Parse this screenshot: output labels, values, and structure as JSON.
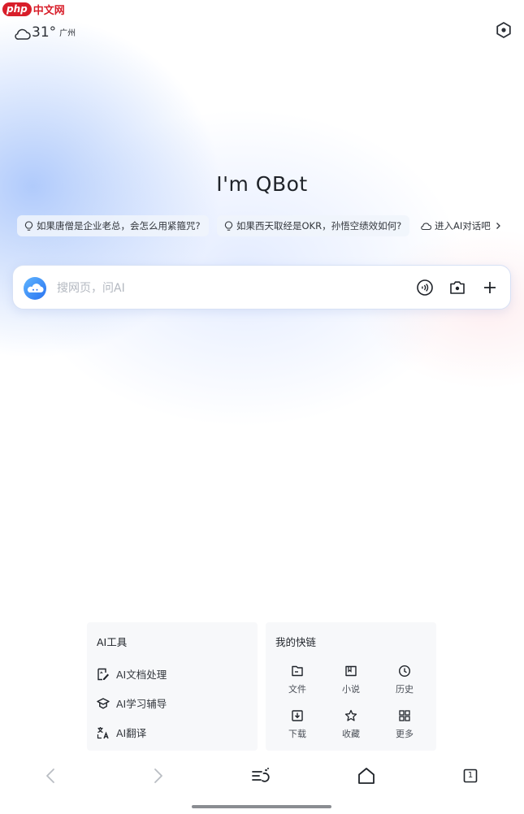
{
  "watermark": {
    "badge": "php",
    "text": "中文网"
  },
  "weather": {
    "temperature": "31°",
    "city": "广州",
    "icon": "cloud-icon"
  },
  "header": {
    "settings_icon": "hexagon-settings-icon"
  },
  "headline": "I'm QBot",
  "suggestions": [
    {
      "text": "如果唐僧是企业老总，会怎么用紧箍咒?",
      "icon": "lightbulb-icon"
    },
    {
      "text": "如果西天取经是OKR，孙悟空绩效如何?",
      "icon": "lightbulb-icon"
    },
    {
      "text": "进入AI对话吧",
      "icon": "cloud-chat-icon"
    }
  ],
  "search": {
    "placeholder": "搜网页，问AI",
    "value": "",
    "buttons": [
      "voice-icon",
      "camera-icon",
      "plus-icon"
    ]
  },
  "ai_tools": {
    "title": "AI工具",
    "items": [
      {
        "label": "AI文档处理",
        "icon": "doc-edit-icon"
      },
      {
        "label": "AI学习辅导",
        "icon": "graduation-cap-icon"
      },
      {
        "label": "AI翻译",
        "icon": "translate-icon"
      }
    ]
  },
  "shortcuts": {
    "title": "我的快链",
    "items": [
      {
        "label": "文件",
        "icon": "folder-icon"
      },
      {
        "label": "小说",
        "icon": "book-icon"
      },
      {
        "label": "历史",
        "icon": "clock-icon"
      },
      {
        "label": "下载",
        "icon": "download-icon"
      },
      {
        "label": "收藏",
        "icon": "star-icon"
      },
      {
        "label": "更多",
        "icon": "grid-icon"
      }
    ]
  },
  "bottom_nav": {
    "items": [
      "back-icon",
      "forward-icon",
      "feed-icon",
      "home-icon",
      "tabs-icon"
    ],
    "tab_count": "1"
  },
  "colors": {
    "brand_blue": "#3a8dff",
    "watermark_red": "#d81e2a"
  }
}
